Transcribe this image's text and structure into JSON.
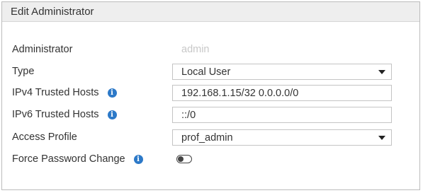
{
  "dialog": {
    "title": "Edit Administrator"
  },
  "form": {
    "administrator": {
      "label": "Administrator",
      "value": "admin"
    },
    "type": {
      "label": "Type",
      "value": "Local User"
    },
    "ipv4": {
      "label": "IPv4 Trusted Hosts",
      "value": "192.168.1.15/32 0.0.0.0/0"
    },
    "ipv6": {
      "label": "IPv6 Trusted Hosts",
      "value": "::/0"
    },
    "access_profile": {
      "label": "Access Profile",
      "value": "prof_admin"
    },
    "force_password_change": {
      "label": "Force Password Change",
      "enabled": false
    }
  },
  "icons": {
    "info_glyph": "i",
    "info_icon_color": "#2c79c8"
  }
}
